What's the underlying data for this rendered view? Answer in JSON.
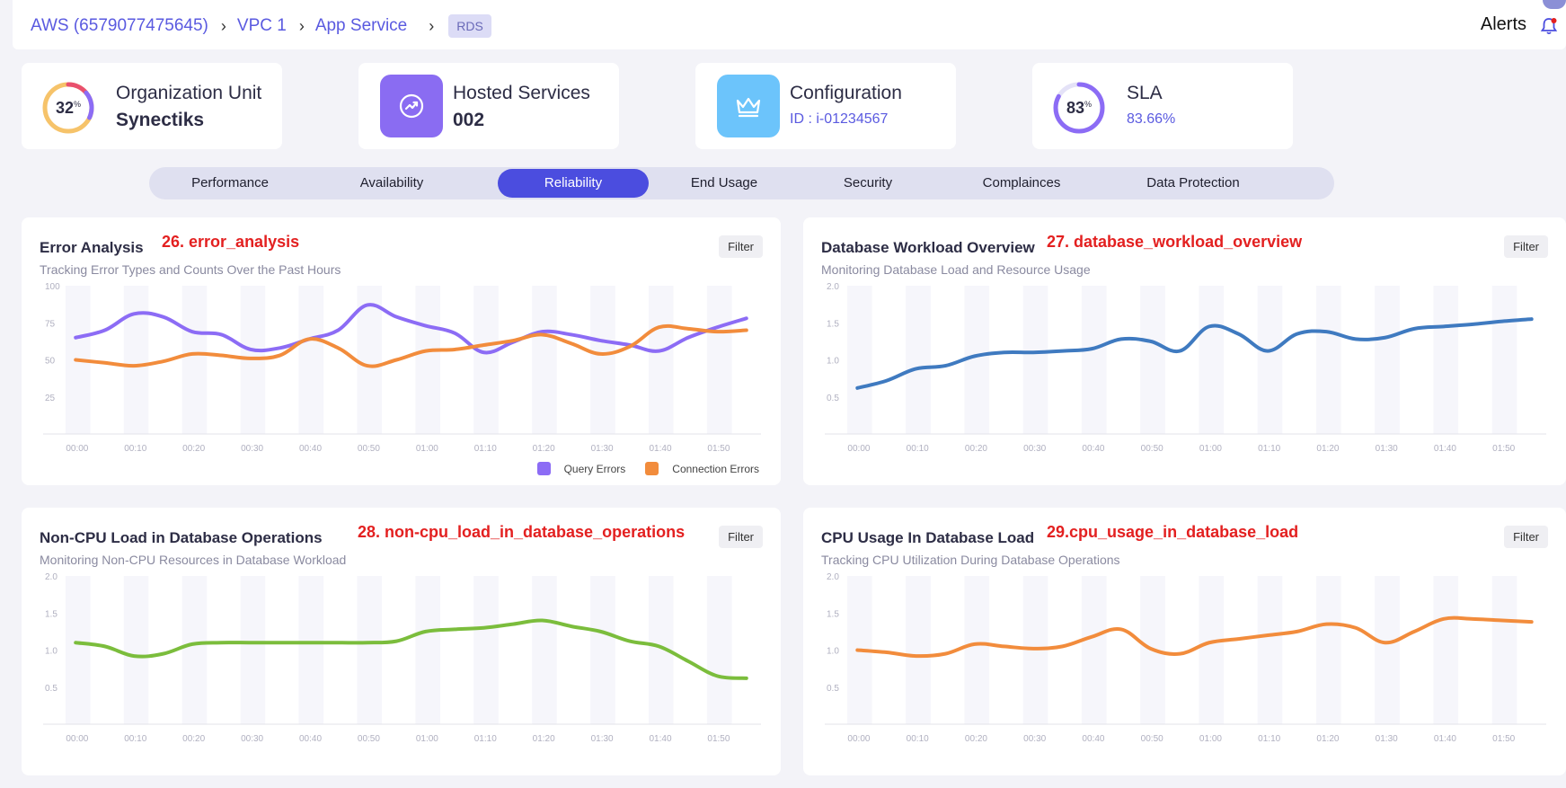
{
  "breadcrumb": {
    "items": [
      "AWS (6579077475645)",
      "VPC 1",
      "App Service"
    ],
    "badge": "RDS"
  },
  "header": {
    "alerts_label": "Alerts"
  },
  "summary": {
    "org_unit": {
      "title": "Organization Unit",
      "value": "Synectiks",
      "percent": "32",
      "percent_sign": "%",
      "fraction": 0.32
    },
    "hosted": {
      "title": "Hosted Services",
      "value": "002"
    },
    "config": {
      "title": "Configuration",
      "value": "ID : i-01234567"
    },
    "sla": {
      "title": "SLA",
      "value": "83.66%",
      "percent": "83",
      "percent_sign": "%",
      "fraction": 0.83
    }
  },
  "tabs": [
    "Performance",
    "Availability",
    "Reliability",
    "End Usage",
    "Security",
    "Complainces",
    "Data Protection"
  ],
  "active_tab": "Reliability",
  "colors": {
    "accent": "#4b4ddf",
    "purple": "#8c6cf5",
    "orange": "#f28c3c",
    "blue": "#3f7ac0",
    "green": "#7bbd3c",
    "tag_red": "#e32020"
  },
  "panels": {
    "error": {
      "title": "Error Analysis",
      "tag": "26. error_analysis",
      "subtitle": "Tracking Error Types and Counts Over the Past Hours",
      "filter": "Filter"
    },
    "workload": {
      "title": "Database Workload Overview",
      "tag": "27. database_workload_overview",
      "subtitle": "Monitoring Database Load and Resource Usage",
      "filter": "Filter"
    },
    "noncpu": {
      "title": "Non-CPU Load in Database Operations",
      "tag": "28. non-cpu_load_in_database_operations",
      "subtitle": "Monitoring Non-CPU Resources in Database Workload",
      "filter": "Filter"
    },
    "cpu": {
      "title": "CPU Usage In Database Load",
      "tag": "29.cpu_usage_in_database_load",
      "subtitle": "Tracking CPU Utilization During Database Operations",
      "filter": "Filter"
    }
  },
  "chart_data": [
    {
      "type": "line",
      "x": [
        "00:00",
        "00:05",
        "00:10",
        "00:15",
        "00:20",
        "00:25",
        "00:30",
        "00:35",
        "00:40",
        "00:45",
        "00:50",
        "00:55",
        "01:00",
        "01:05",
        "01:10",
        "01:15",
        "01:20",
        "01:25",
        "01:30",
        "01:35",
        "01:40",
        "01:45",
        "01:50",
        "01:55"
      ],
      "xticks": [
        "00:00",
        "00:10",
        "00:20",
        "00:30",
        "00:40",
        "00:50",
        "01:00",
        "01:10",
        "01:20",
        "01:30",
        "01:40",
        "01:50"
      ],
      "yticks": [
        "100",
        "75",
        "50",
        "25"
      ],
      "ylim": [
        0,
        100
      ],
      "series": [
        {
          "name": "Query Errors",
          "color": "#8c6cf5",
          "values": [
            65,
            70,
            81,
            79,
            69,
            67,
            57,
            58,
            64,
            70,
            87,
            79,
            73,
            68,
            55,
            62,
            69,
            67,
            63,
            60,
            56,
            65,
            72,
            78
          ]
        },
        {
          "name": "Connection Errors",
          "color": "#f28c3c",
          "values": [
            50,
            48,
            46,
            49,
            54,
            53,
            51,
            53,
            64,
            58,
            46,
            50,
            56,
            57,
            60,
            63,
            67,
            61,
            54,
            59,
            72,
            71,
            69,
            70
          ]
        }
      ],
      "legend": "bottom-right"
    },
    {
      "type": "line",
      "x": [
        "00:00",
        "00:05",
        "00:10",
        "00:15",
        "00:20",
        "00:25",
        "00:30",
        "00:35",
        "00:40",
        "00:45",
        "00:50",
        "00:55",
        "01:00",
        "01:05",
        "01:10",
        "01:15",
        "01:20",
        "01:25",
        "01:30",
        "01:35",
        "01:40",
        "01:45",
        "01:50",
        "01:55"
      ],
      "xticks": [
        "00:00",
        "00:10",
        "00:20",
        "00:30",
        "00:40",
        "00:50",
        "01:00",
        "01:10",
        "01:20",
        "01:30",
        "01:40",
        "01:50"
      ],
      "yticks": [
        "2.0",
        "1.5",
        "1.0",
        "0.5"
      ],
      "ylim": [
        0,
        2
      ],
      "series": [
        {
          "color": "#3f7ac0",
          "values": [
            0.62,
            0.72,
            0.88,
            0.92,
            1.05,
            1.1,
            1.1,
            1.12,
            1.15,
            1.28,
            1.25,
            1.12,
            1.45,
            1.35,
            1.12,
            1.35,
            1.38,
            1.28,
            1.3,
            1.42,
            1.45,
            1.48,
            1.52,
            1.55
          ]
        }
      ]
    },
    {
      "type": "line",
      "x": [
        "00:00",
        "00:05",
        "00:10",
        "00:15",
        "00:20",
        "00:25",
        "00:30",
        "00:35",
        "00:40",
        "00:45",
        "00:50",
        "00:55",
        "01:00",
        "01:05",
        "01:10",
        "01:15",
        "01:20",
        "01:25",
        "01:30",
        "01:35",
        "01:40",
        "01:45",
        "01:50",
        "01:55"
      ],
      "xticks": [
        "00:00",
        "00:10",
        "00:20",
        "00:30",
        "00:40",
        "00:50",
        "01:00",
        "01:10",
        "01:20",
        "01:30",
        "01:40",
        "01:50"
      ],
      "yticks": [
        "2.0",
        "1.5",
        "1.0",
        "0.5"
      ],
      "ylim": [
        0,
        2
      ],
      "series": [
        {
          "color": "#7bbd3c",
          "values": [
            1.1,
            1.05,
            0.92,
            0.95,
            1.08,
            1.1,
            1.1,
            1.1,
            1.1,
            1.1,
            1.1,
            1.12,
            1.25,
            1.28,
            1.3,
            1.35,
            1.4,
            1.32,
            1.25,
            1.12,
            1.05,
            0.85,
            0.65,
            0.62
          ]
        }
      ]
    },
    {
      "type": "line",
      "x": [
        "00:00",
        "00:05",
        "00:10",
        "00:15",
        "00:20",
        "00:25",
        "00:30",
        "00:35",
        "00:40",
        "00:45",
        "00:50",
        "00:55",
        "01:00",
        "01:05",
        "01:10",
        "01:15",
        "01:20",
        "01:25",
        "01:30",
        "01:35",
        "01:40",
        "01:45",
        "01:50",
        "01:55"
      ],
      "xticks": [
        "00:00",
        "00:10",
        "00:20",
        "00:30",
        "00:40",
        "00:50",
        "01:00",
        "01:10",
        "01:20",
        "01:30",
        "01:40",
        "01:50"
      ],
      "yticks": [
        "2.0",
        "1.5",
        "1.0",
        "0.5"
      ],
      "ylim": [
        0,
        2
      ],
      "series": [
        {
          "color": "#f28c3c",
          "values": [
            1.0,
            0.97,
            0.92,
            0.95,
            1.08,
            1.05,
            1.02,
            1.05,
            1.18,
            1.28,
            1.02,
            0.95,
            1.1,
            1.15,
            1.2,
            1.25,
            1.35,
            1.3,
            1.1,
            1.25,
            1.42,
            1.42,
            1.4,
            1.38
          ]
        }
      ]
    }
  ]
}
